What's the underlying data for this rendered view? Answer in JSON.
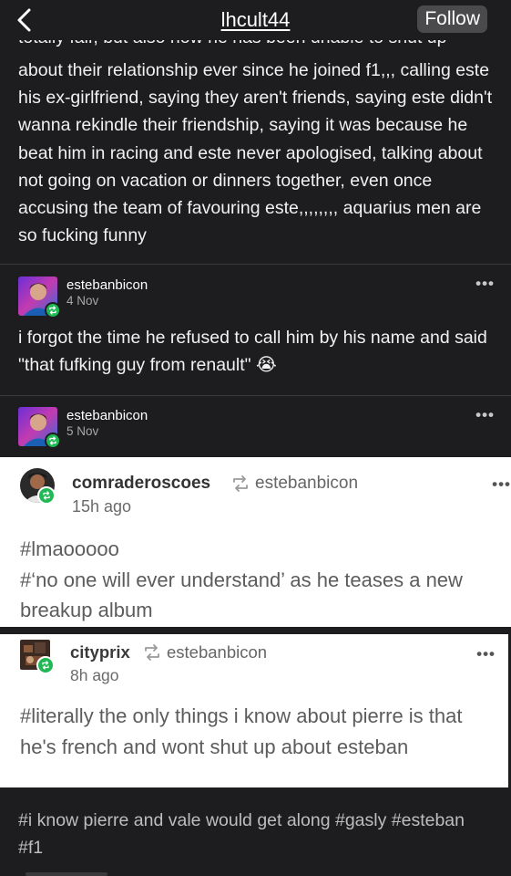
{
  "header": {
    "title": "lhcult44",
    "follow_label": "Follow"
  },
  "post": {
    "clipped_line": "totally fair, but also how he has been unable to shut up",
    "body": "about their relationship ever since he joined f1,,, calling este his ex-girlfriend, saying they aren't friends, saying este didn't wanna rekindle their friendship, saying it was because he beat him in racing and este never apologised, talking about not going on vacation or dinners together, even once accusing the team of favouring este,,,,,,,, aquarius men are so fucking funny"
  },
  "reblogs": [
    {
      "username": "estebanbicon",
      "date": "4 Nov",
      "text": "i forgot the time he refused to call him by his name and said \"that fufking guy from renault\" 😭"
    },
    {
      "username": "estebanbicon",
      "date": "5 Nov"
    }
  ],
  "cards": [
    {
      "username": "comraderoscoes",
      "via": "estebanbicon",
      "time": "15h ago",
      "tags": [
        "#lmaooooo",
        "#‘no one will ever understand’ as he teases a new breakup album"
      ]
    },
    {
      "username": "cityprix",
      "via": "estebanbicon",
      "time": "8h ago",
      "tags": [
        "#literally the only things i know about pierre is that he's french and wont shut up about esteban"
      ]
    }
  ],
  "bottom_tags": "#i know pierre and vale would get along  #gasly  #esteban  #f1",
  "icons": {
    "back": "chevron-left-icon",
    "more": "more-dots-icon",
    "reblog": "reblog-icon"
  },
  "colors": {
    "background": "#1d1d1f",
    "reblog_green": "#1fb854",
    "card_bg": "#ffffff"
  }
}
